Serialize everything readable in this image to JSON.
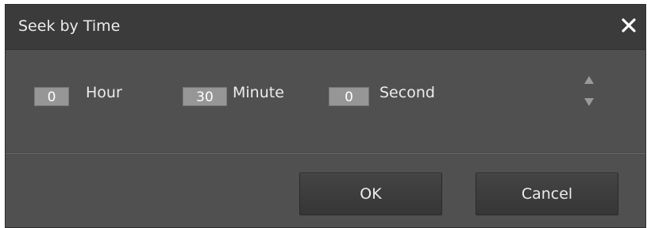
{
  "dialog": {
    "title": "Seek by Time",
    "close_icon": "close-icon"
  },
  "fields": {
    "hour": {
      "value": "0",
      "label": "Hour"
    },
    "minute": {
      "value": "30",
      "label": "Minute"
    },
    "second": {
      "value": "0",
      "label": "Second"
    }
  },
  "spinner": {
    "up_icon": "triangle-up-icon",
    "down_icon": "triangle-down-icon"
  },
  "buttons": {
    "ok_label": "OK",
    "cancel_label": "Cancel"
  },
  "colors": {
    "dialog_bg": "#505050",
    "titlebar_bg": "#3b3b3b",
    "input_bg": "#969696",
    "text": "#ececec"
  }
}
